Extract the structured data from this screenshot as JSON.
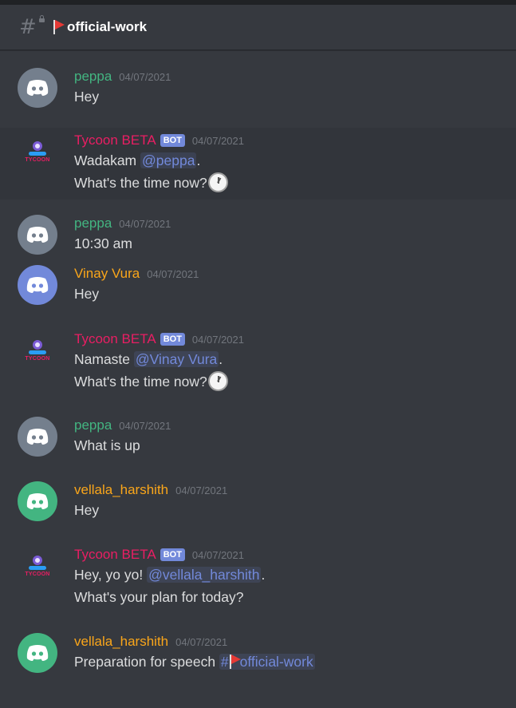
{
  "header": {
    "channel_name": "official-work"
  },
  "colors": {
    "peppa": "#43b581",
    "bot": "#e91e63",
    "vinay": "#faa61a",
    "vellala": "#faa61a",
    "mention": "#7289da",
    "background": "#36393f"
  },
  "messages": [
    {
      "author": "peppa",
      "timestamp": "04/07/2021",
      "lines": [
        "Hey"
      ]
    },
    {
      "author": "Tycoon BETA",
      "badge": "BOT",
      "timestamp": "04/07/2021",
      "line1_prefix": "Wadakam ",
      "mention": "@peppa",
      "line1_suffix": ".",
      "line2": "What's the time now?",
      "avatar_text": "TYCOON"
    },
    {
      "author": "peppa",
      "timestamp": "04/07/2021",
      "lines": [
        "10:30 am"
      ]
    },
    {
      "author": "Vinay Vura",
      "timestamp": "04/07/2021",
      "lines": [
        "Hey"
      ]
    },
    {
      "author": "Tycoon BETA",
      "badge": "BOT",
      "timestamp": "04/07/2021",
      "line1_prefix": "Namaste ",
      "mention": "@Vinay Vura",
      "line1_suffix": ".",
      "line2": "What's the time now?",
      "avatar_text": "TYCOON"
    },
    {
      "author": "peppa",
      "timestamp": "04/07/2021",
      "lines": [
        "What is up"
      ]
    },
    {
      "author": "vellala_harshith",
      "timestamp": "04/07/2021",
      "lines": [
        "Hey"
      ]
    },
    {
      "author": "Tycoon BETA",
      "badge": "BOT",
      "timestamp": "04/07/2021",
      "line1_prefix": "Hey, yo yo! ",
      "mention": "@vellala_harshith",
      "line1_suffix": ".",
      "line2": "What's your plan for today?",
      "avatar_text": "TYCOON"
    },
    {
      "author": "vellala_harshith",
      "timestamp": "04/07/2021",
      "line1_prefix": "Preparation for speech ",
      "channel_mention": "official-work"
    }
  ]
}
